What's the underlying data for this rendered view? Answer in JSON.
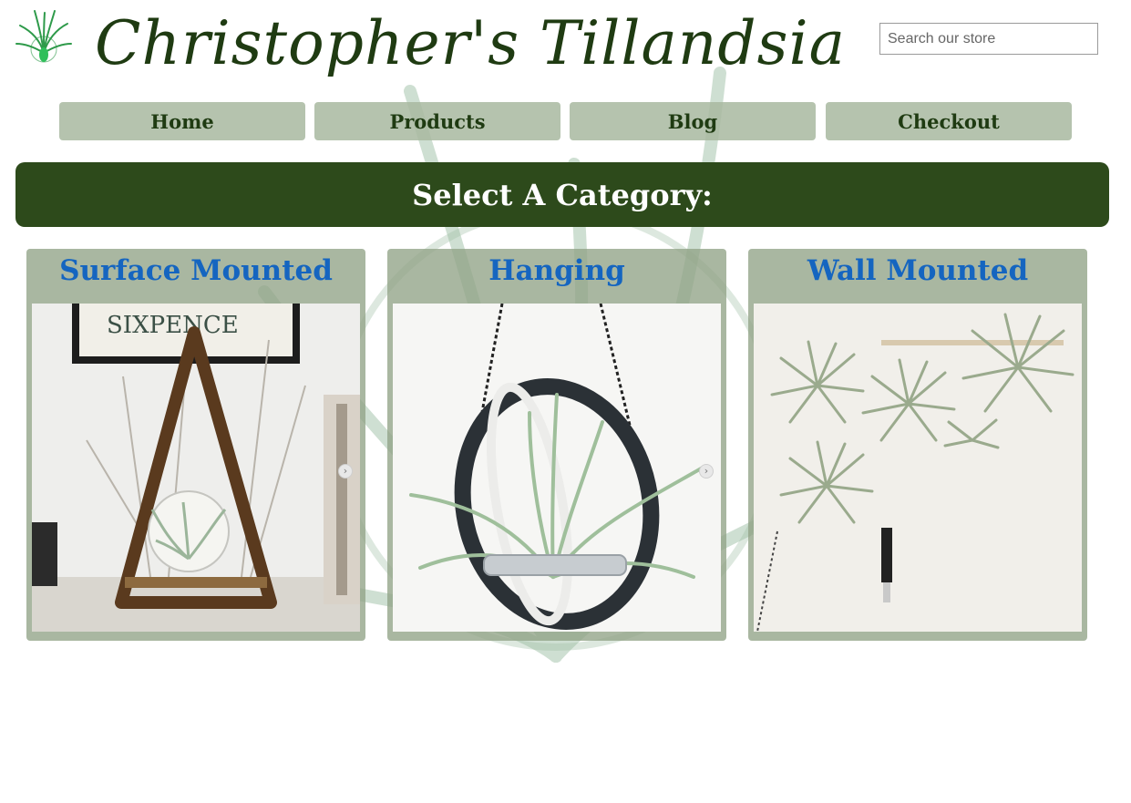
{
  "header": {
    "brand": "Christopher's Tillandsia",
    "logo_icon": "tillandsia-logo-icon",
    "search": {
      "placeholder": "Search our store",
      "value": ""
    }
  },
  "nav": [
    {
      "label": "Home"
    },
    {
      "label": "Products"
    },
    {
      "label": "Blog"
    },
    {
      "label": "Checkout"
    }
  ],
  "category_heading": "Select A Category:",
  "categories": [
    {
      "label": "Surface Mounted",
      "image": "triangle-stand-terrarium-image"
    },
    {
      "label": "Hanging",
      "image": "hanging-ring-air-plant-image"
    },
    {
      "label": "Wall Mounted",
      "image": "wall-air-plants-image"
    }
  ],
  "colors": {
    "brand_text": "#1f3b12",
    "nav_bg": "#a8b8a0",
    "category_bar": "#2d4a1b",
    "card_bg": "#91a387",
    "card_title": "#1565c0"
  }
}
